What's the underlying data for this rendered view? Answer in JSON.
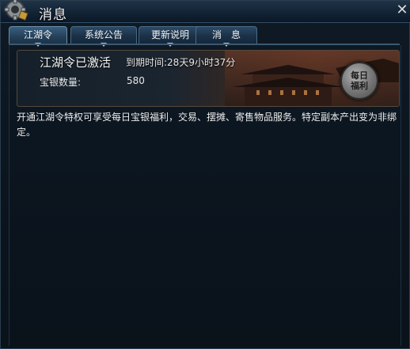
{
  "window": {
    "title": "消息",
    "close_glyph": "✕"
  },
  "tabs": [
    {
      "label": "江湖令"
    },
    {
      "label": "系统公告"
    },
    {
      "label": "更新说明"
    },
    {
      "label": "消　息"
    }
  ],
  "banner": {
    "title": "江湖令已激活",
    "expire": "到期时间:28天9小时37分",
    "silver_label": "宝银数量:",
    "silver_value": "580",
    "badge_line1": "每日",
    "badge_line2": "福利"
  },
  "description": "开通江湖令特权可享受每日宝银福利，交易、摆摊、寄售物品服务。特定副本产出变为非绑定。",
  "colors": {
    "accent": "#2c4a66",
    "background": "#0b121a",
    "text": "#ececec"
  },
  "icons": {
    "title": "gear-icon",
    "close": "close-icon",
    "badge": "seal-icon"
  }
}
